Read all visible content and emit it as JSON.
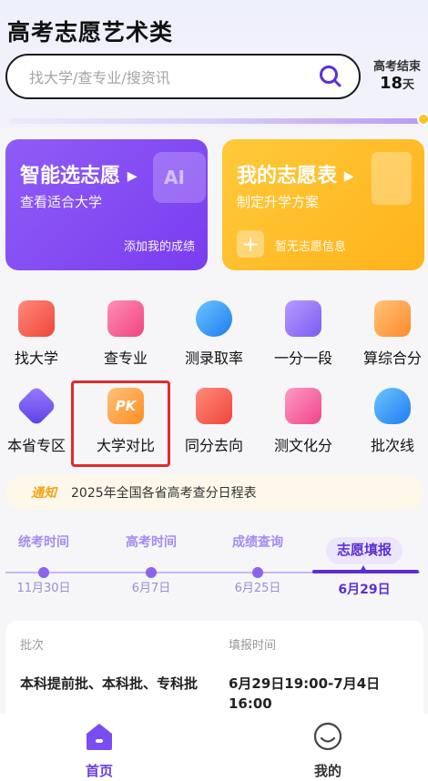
{
  "header": {
    "title": "高考志愿艺术类"
  },
  "search": {
    "placeholder": "找大学/查专业/搜资讯"
  },
  "countdown": {
    "label": "高考结束",
    "value": "18",
    "unit": "天"
  },
  "cards": {
    "smart": {
      "title": "智能选志愿",
      "arrow": "▸",
      "subtitle": "查看适合大学",
      "action": "添加我的成绩",
      "deco": "AI"
    },
    "mine": {
      "title": "我的志愿表",
      "arrow": "▸",
      "subtitle": "制定升学方案",
      "action": "暂无志愿信息",
      "plus": "+"
    }
  },
  "grid": {
    "row1": [
      "找大学",
      "查专业",
      "测录取率",
      "一分一段",
      "算综合分"
    ],
    "row2": [
      "本省专区",
      "大学对比",
      "同分去向",
      "测文化分",
      "批次线"
    ],
    "pk_label": "PK"
  },
  "notice": {
    "tag": "通知",
    "text": "2025年全国各省高考查分日程表"
  },
  "timeline": {
    "steps": [
      {
        "label": "统考时间",
        "date": "11月30日"
      },
      {
        "label": "高考时间",
        "date": "6月7日"
      },
      {
        "label": "成绩查询",
        "date": "6月25日"
      },
      {
        "label": "志愿填报",
        "date": "6月29日"
      }
    ],
    "active_index": 3
  },
  "table": {
    "headers": [
      "批次",
      "填报时间"
    ],
    "rows": [
      {
        "batch": "本科提前批、本科批、专科批",
        "time": "6月29日19:00-7月4日16:00"
      }
    ]
  },
  "tabbar": {
    "home": "首页",
    "mine": "我的"
  },
  "colors": {
    "accent": "#7a3df0",
    "active": "#5b2fd4",
    "yellow": "#ffb31a",
    "highlight": "#e02c2c"
  }
}
